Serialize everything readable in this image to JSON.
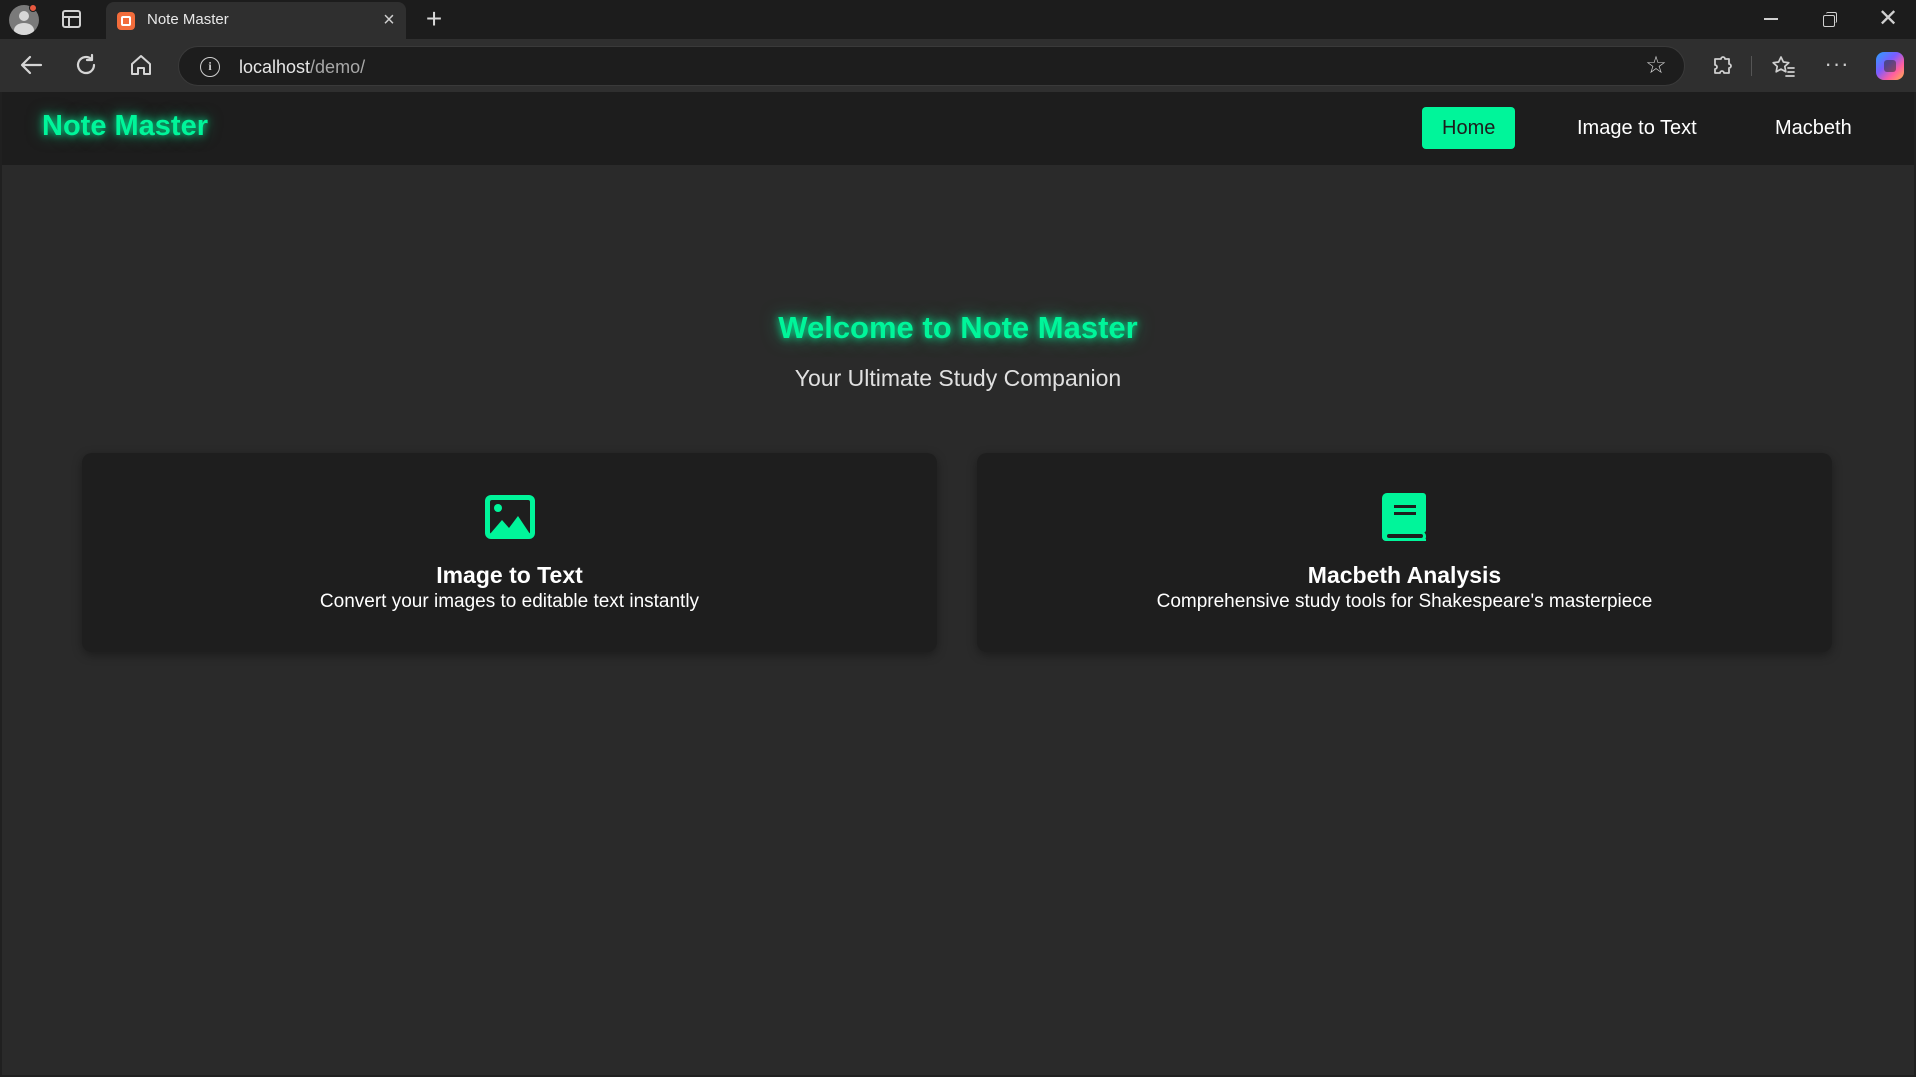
{
  "browser": {
    "tab_title": "Note Master",
    "url_host": "localhost",
    "url_path": "/demo/"
  },
  "site": {
    "brand": "Note Master",
    "nav": [
      {
        "label": "Home",
        "active": true
      },
      {
        "label": "Image to Text",
        "active": false
      },
      {
        "label": "Macbeth",
        "active": false
      }
    ]
  },
  "hero": {
    "title": "Welcome to Note Master",
    "subtitle": "Your Ultimate Study Companion"
  },
  "cards": [
    {
      "icon": "image-icon",
      "title": "Image to Text",
      "description": "Convert your images to editable text instantly"
    },
    {
      "icon": "book-icon",
      "title": "Macbeth Analysis",
      "description": "Comprehensive study tools for Shakespeare's masterpiece"
    }
  ],
  "colors": {
    "accent": "#00f59a",
    "nav_background": "#1d1d1d",
    "page_background": "#2a2a2a",
    "card_background": "#1e1e1e"
  }
}
